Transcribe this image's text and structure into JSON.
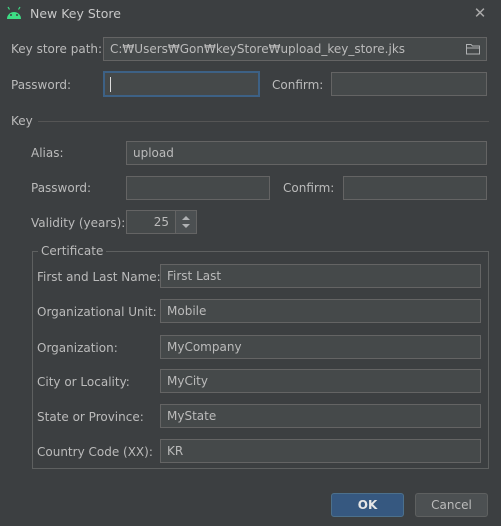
{
  "window": {
    "title": "New Key Store",
    "close_glyph": "✕"
  },
  "keystore": {
    "path_label": "Key store path:",
    "path_value": "C:₩Users₩Gon₩keyStore₩upload_key_store.jks",
    "password_label": "Password:",
    "password_value": "",
    "confirm_label": "Confirm:",
    "confirm_value": ""
  },
  "key": {
    "section_label": "Key",
    "alias_label": "Alias:",
    "alias_value": "upload",
    "password_label": "Password:",
    "password_value": "",
    "confirm_label": "Confirm:",
    "confirm_value": "",
    "validity_label": "Validity (years):",
    "validity_value": "25"
  },
  "certificate": {
    "title": "Certificate",
    "first_last_label": "First and Last Name:",
    "first_last_value": "First Last",
    "org_unit_label": "Organizational Unit:",
    "org_unit_value": "Mobile",
    "org_label": "Organization:",
    "org_value": "MyCompany",
    "city_label": "City or Locality:",
    "city_value": "MyCity",
    "state_label": "State or Province:",
    "state_value": "MyState",
    "country_label": "Country Code (XX):",
    "country_value": "KR"
  },
  "buttons": {
    "ok": "OK",
    "cancel": "Cancel"
  },
  "colors": {
    "background": "#3c3f41",
    "field": "#45494a",
    "focus_border": "#3d6185",
    "ok_button": "#365880",
    "android_green": "#3ddc84"
  },
  "icons": {
    "app": "android-icon",
    "browse": "folder-icon",
    "spinner": "up-down-arrows-icon"
  }
}
